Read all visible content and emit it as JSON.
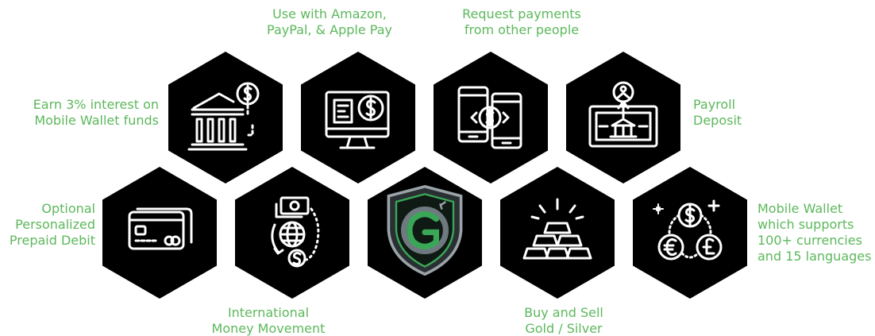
{
  "colors": {
    "accent": "#5cb85c",
    "hex_fill": "#000000",
    "icon_stroke": "#ffffff",
    "shield_green": "#3aa757"
  },
  "features": [
    {
      "id": "interest",
      "lines": [
        "Earn 3% interest on",
        "Mobile Wallet funds"
      ],
      "icon": "bank-dollar-icon"
    },
    {
      "id": "shopping",
      "lines": [
        "Use with Amazon,",
        "PayPal, & Apple Pay"
      ],
      "icon": "monitor-dollar-icon"
    },
    {
      "id": "request",
      "lines": [
        "Request payments",
        "from other people"
      ],
      "icon": "phones-transfer-icon"
    },
    {
      "id": "payroll",
      "lines": [
        "Payroll",
        "Deposit"
      ],
      "icon": "payroll-deposit-icon"
    },
    {
      "id": "debit",
      "lines": [
        "Optional",
        "Personalized",
        "Prepaid Debit"
      ],
      "icon": "debit-card-icon"
    },
    {
      "id": "international",
      "lines": [
        "International",
        "Money Movement"
      ],
      "icon": "globe-money-icon"
    },
    {
      "id": "logo",
      "lines": [],
      "icon": "shield-logo-icon"
    },
    {
      "id": "gold",
      "lines": [
        "Buy and Sell",
        "Gold / Silver"
      ],
      "icon": "gold-bars-icon"
    },
    {
      "id": "currencies",
      "lines": [
        "Mobile Wallet",
        "which supports",
        "100+ currencies",
        "and 15 languages"
      ],
      "icon": "currency-coins-icon"
    }
  ]
}
